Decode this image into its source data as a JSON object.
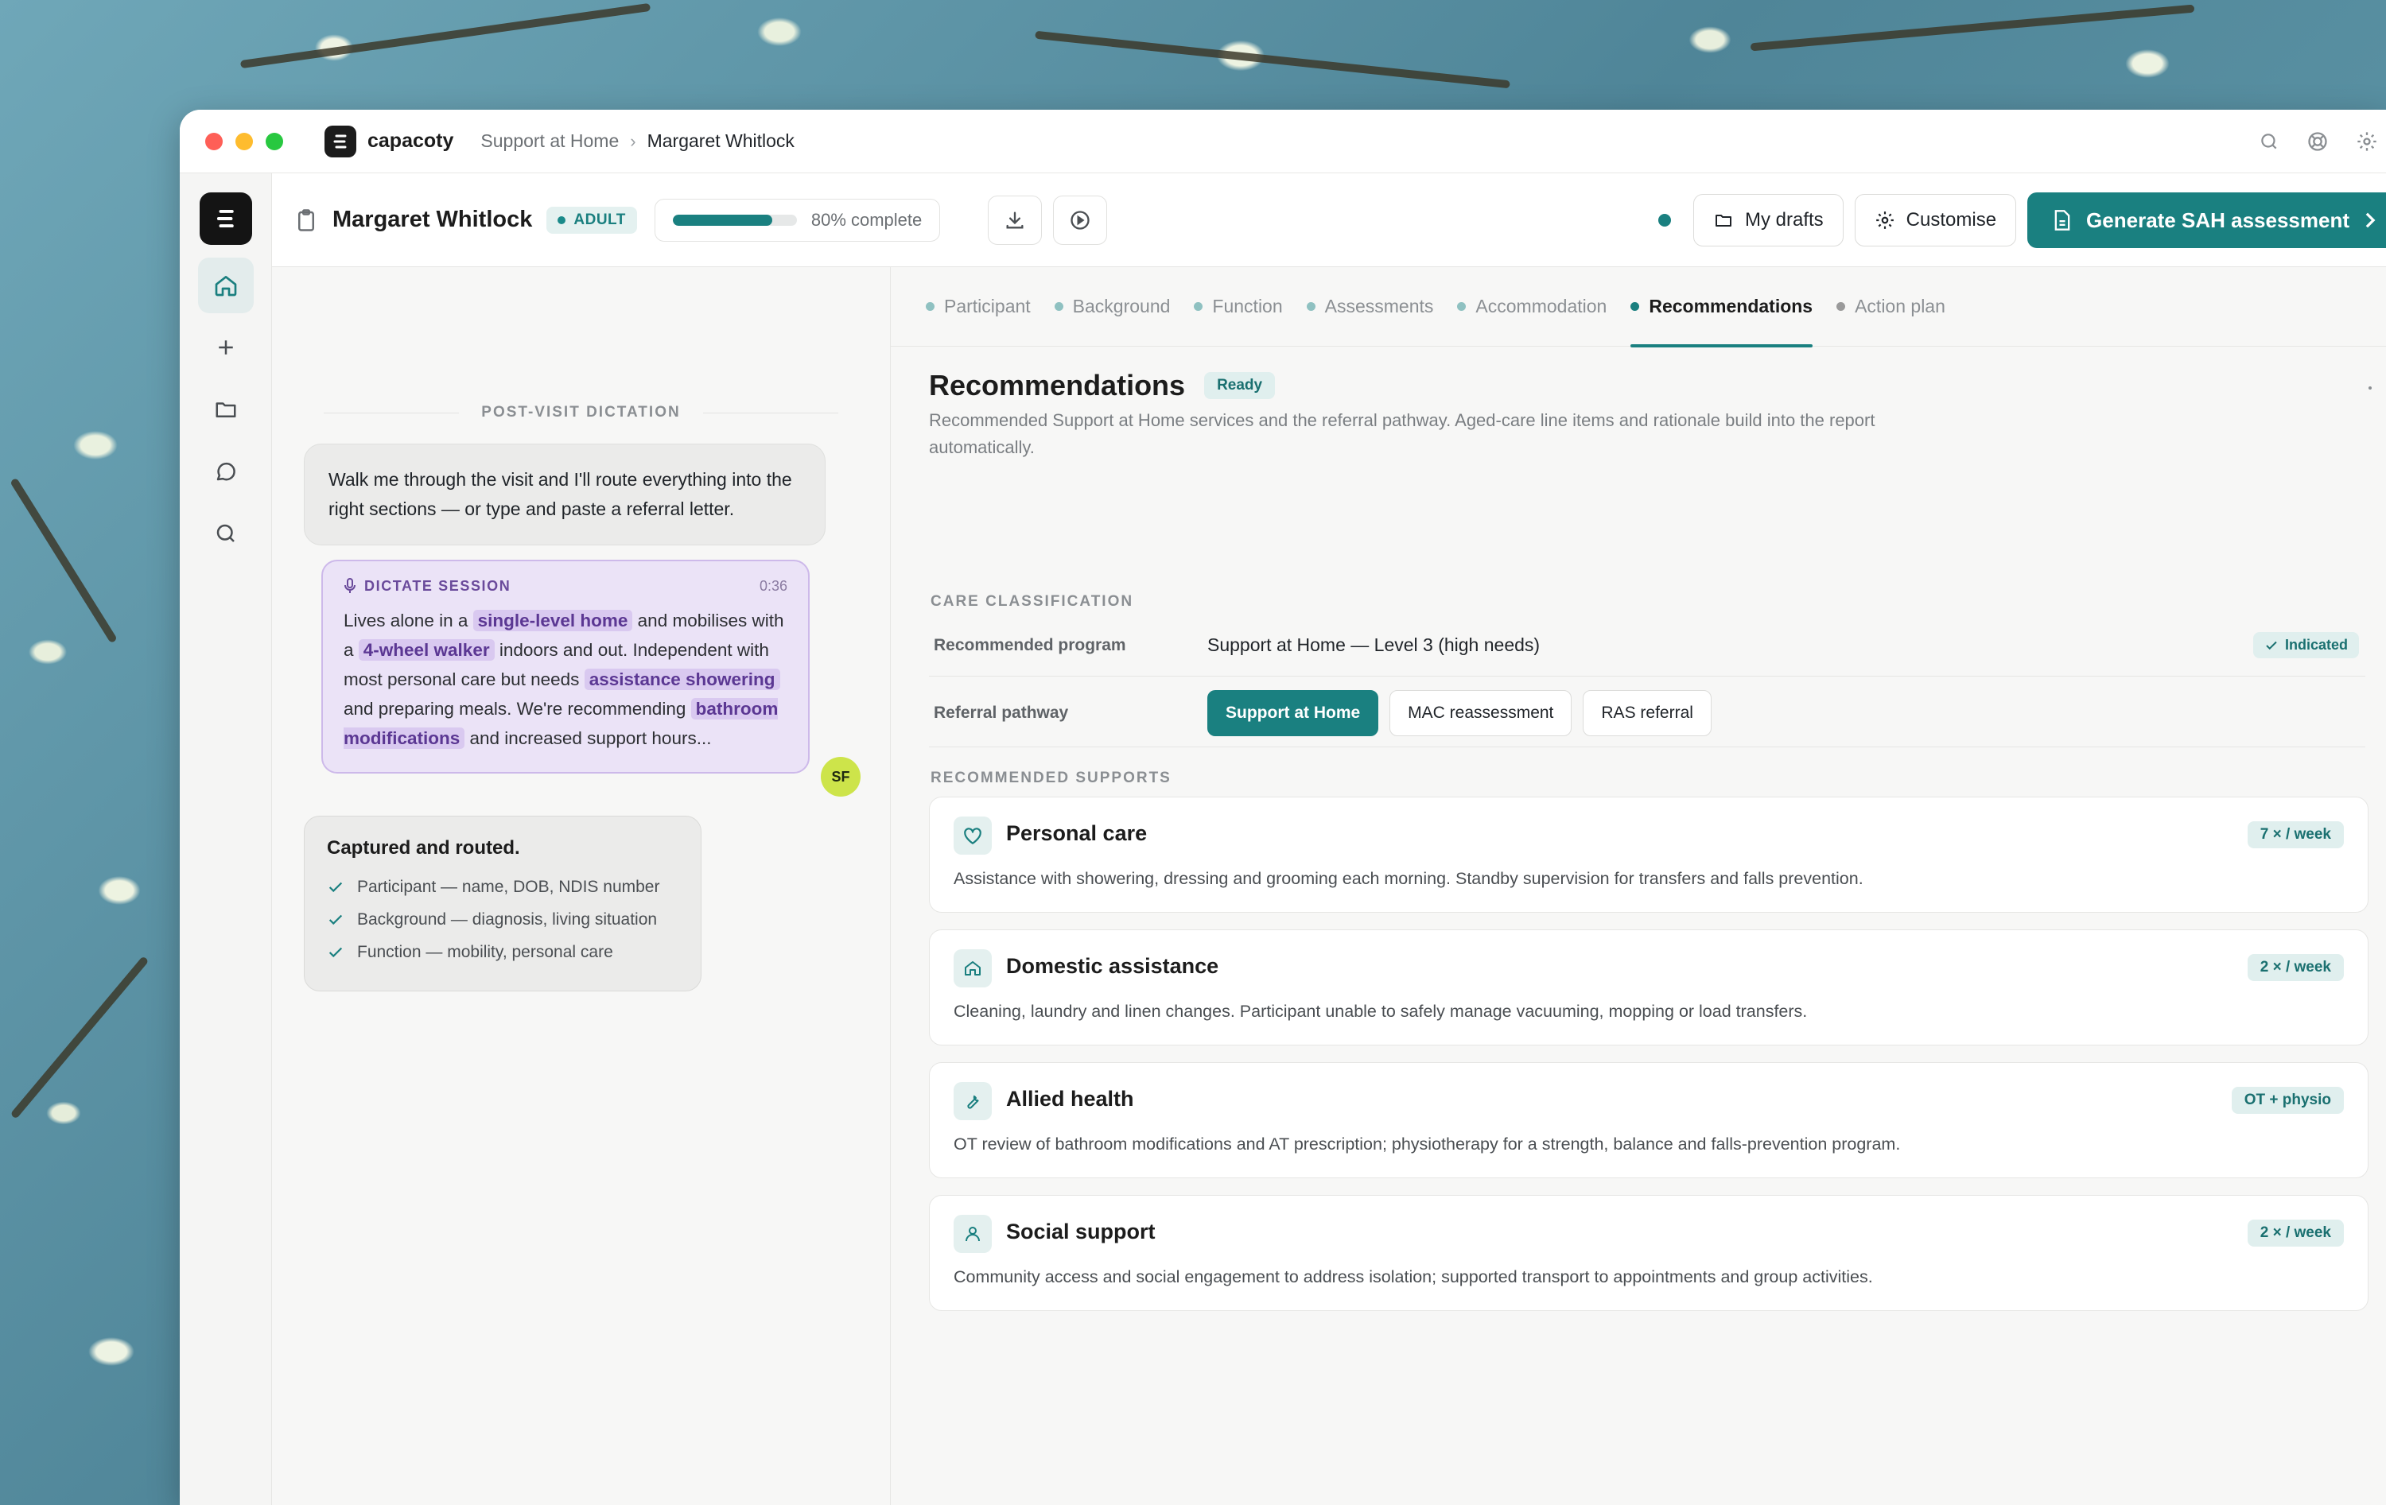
{
  "app": {
    "name": "capacoty"
  },
  "breadcrumb": {
    "parent": "Support at Home",
    "separator": "›",
    "current": "Margaret Whitlock"
  },
  "colors": {
    "accent": "#1a8080",
    "highlight": "#d9c9f0",
    "badge_bg": "#e0efee",
    "avatar": "#cde44a"
  },
  "header": {
    "participant_name": "Margaret Whitlock",
    "badge": "ADULT",
    "progress": {
      "fraction": 0.8,
      "label": "80% complete"
    },
    "my_drafts_label": "My drafts",
    "customise_label": "Customise",
    "generate_label": "Generate SAH assessment"
  },
  "dictation": {
    "section_label": "POST-VISIT DICTATION",
    "prompt": "Walk me through the visit and I'll route everything into the right sections — or type and paste a referral letter.",
    "session": {
      "title": "DICTATE SESSION",
      "time": "0:36",
      "t1": "Lives alone in a ",
      "h1": "single-level home",
      "t2": " and mobilises with a ",
      "h2": "4-wheel walker",
      "t3": " indoors and out. Independent with most personal care but needs ",
      "h3": "assistance showering",
      "t4": " and preparing meals. We're recommending ",
      "h4": "bathroom modifications",
      "t5": " and increased support hours..."
    },
    "avatar_initials": "SF",
    "captured": {
      "title": "Captured and routed.",
      "items": [
        "Participant — name, DOB, NDIS number",
        "Background — diagnosis, living situation",
        "Function — mobility, personal care"
      ]
    }
  },
  "tabs": [
    "Participant",
    "Background",
    "Function",
    "Assessments",
    "Accommodation",
    "Recommendations",
    "Action plan"
  ],
  "recommendations": {
    "title": "Recommendations",
    "status": "Ready",
    "description": "Recommended Support at Home services and the referral pathway. Aged-care line items and rationale build into the report automatically.",
    "care_classification_label": "CARE CLASSIFICATION",
    "program_label": "Recommended program",
    "program_value": "Support at Home — Level 3 (high needs)",
    "program_status": "Indicated",
    "pathway_label": "Referral pathway",
    "pathway_options": [
      "Support at Home",
      "MAC reassessment",
      "RAS referral"
    ],
    "pathway_selected": "Support at Home",
    "supports_label": "RECOMMENDED SUPPORTS",
    "supports": [
      {
        "icon": "heart-icon",
        "title": "Personal care",
        "frequency": "7 × / week",
        "description": "Assistance with showering, dressing and grooming each morning. Standby supervision for transfers and falls prevention."
      },
      {
        "icon": "home-icon",
        "title": "Domestic assistance",
        "frequency": "2 × / week",
        "description": "Cleaning, laundry and linen changes. Participant unable to safely manage vacuuming, mopping or load transfers."
      },
      {
        "icon": "wrench-icon",
        "title": "Allied health",
        "frequency": "OT + physio",
        "description": "OT review of bathroom modifications and AT prescription; physiotherapy for a strength, balance and falls-prevention program."
      },
      {
        "icon": "person-icon",
        "title": "Social support",
        "frequency": "2 × / week",
        "description": "Community access and social engagement to address isolation; supported transport to appointments and group activities."
      }
    ]
  }
}
